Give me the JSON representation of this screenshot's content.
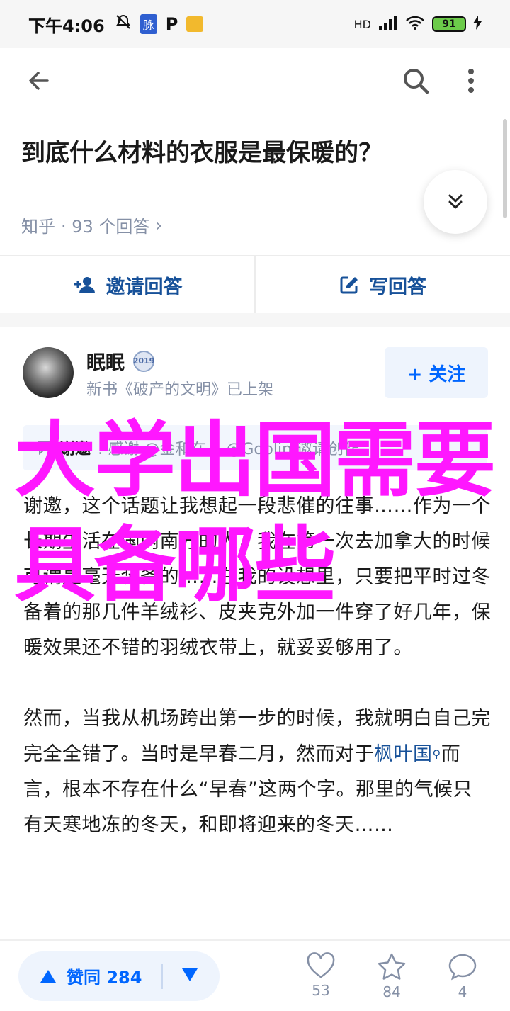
{
  "status_bar": {
    "time": "下午4:06",
    "badge_label": "脉",
    "p_label": "P",
    "network": "HD",
    "battery": "91"
  },
  "question": {
    "title": "到底什么材料的衣服是最保暖的？",
    "source": "知乎",
    "answers_count": "· 93 个回答",
    "chevron": "›"
  },
  "actions": {
    "invite": "邀请回答",
    "write": "写回答"
  },
  "answer": {
    "author": "眠眠",
    "level": "2019",
    "subtitle": "新书《破产的文明》已上架",
    "follow": "+ 关注",
    "invite_note_prefix": "谢邀",
    "invite_note": ": 感谢 @金和在... @Goblin 邀请创作",
    "paragraphs": [
      "谢邀，这个话题让我想起一段悲催的往事……作为一个长期生活在国内南方的人，我在第一次去加拿大的时候可谓是毫无装备的……在我的设想里，只要把平时过冬备着的那几件羊绒衫、皮夹克外加一件穿了好几年，保暖效果还不错的羽绒衣带上，就妥妥够用了。"
    ],
    "p2_part1": "然而，当我从机场跨出第一步的时候，我就明白自己完完全全错了。当时是早春二月，然而对于",
    "p2_link": "枫叶国",
    "p2_part2": "而言，根本不存在什么“早春”这两个字。那里的气候只有天寒地冻的冬天，和即将迎来的冬天……"
  },
  "overlay": {
    "text": "大学出国需要具备哪些"
  },
  "bottom": {
    "vote_label": "赞同 284",
    "like_count": "53",
    "star_count": "84",
    "comment_count": "4"
  },
  "colors": {
    "link_blue": "#175199",
    "primary_blue": "#0066ff",
    "overlay_magenta": "#ff17ff",
    "muted": "#8590a6"
  }
}
